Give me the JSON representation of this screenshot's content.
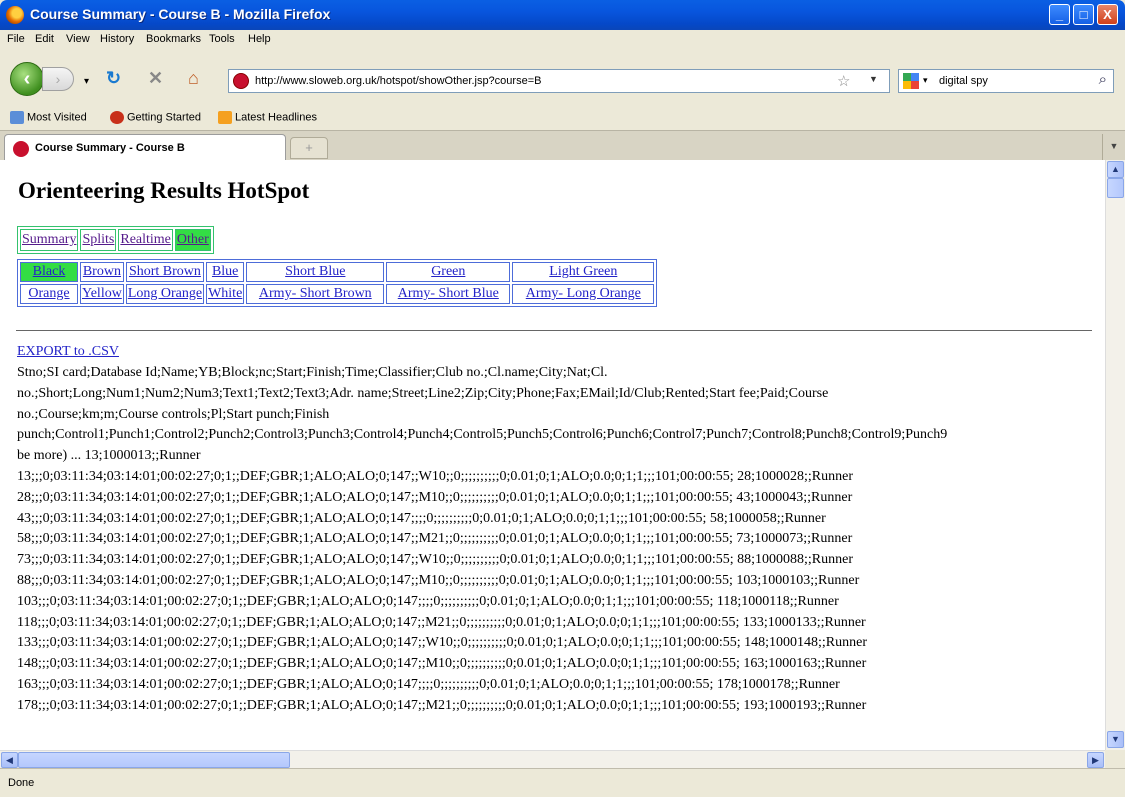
{
  "window": {
    "title": "Course Summary - Course B - Mozilla Firefox",
    "minimize": "_",
    "maximize": "□",
    "close": "X"
  },
  "menu": {
    "items": [
      "File",
      "Edit",
      "View",
      "History",
      "Bookmarks",
      "Tools",
      "Help"
    ]
  },
  "navbar": {
    "url": "http://www.sloweb.org.uk/hotspot/showOther.jsp?course=B",
    "search_query": "digital spy"
  },
  "bookmarks": {
    "items": [
      "Most Visited",
      "Getting Started",
      "Latest Headlines"
    ]
  },
  "tabs": {
    "active_label": "Course Summary - Course B",
    "new_tab": "+"
  },
  "page": {
    "heading": "Orienteering Results HotSpot",
    "topnav": [
      "Summary",
      "Splits",
      "Realtime",
      "Other"
    ],
    "courses_row1": [
      "Black",
      "Brown",
      "Short Brown",
      "Blue",
      "Short Blue",
      "Green",
      "Light Green"
    ],
    "courses_row2": [
      "Orange",
      "Yellow",
      "Long Orange",
      "White",
      "Army- Short Brown",
      "Army- Short Blue",
      "Army- Long Orange"
    ],
    "export_link": "EXPORT to .CSV",
    "lines": [
      "Stno;SI card;Database Id;Name;YB;Block;nc;Start;Finish;Time;Classifier;Club no.;Cl.name;City;Nat;Cl.",
      "no.;Short;Long;Num1;Num2;Num3;Text1;Text2;Text3;Adr. name;Street;Line2;Zip;City;Phone;Fax;EMail;Id/Club;Rented;Start fee;Paid;Course",
      "no.;Course;km;m;Course controls;Pl;Start punch;Finish",
      "punch;Control1;Punch1;Control2;Punch2;Control3;Punch3;Control4;Punch4;Control5;Punch5;Control6;Punch6;Control7;Punch7;Control8;Punch8;Control9;Punch9",
      "be more) ... 13;1000013;;Runner",
      "13;;;0;03:11:34;03:14:01;00:02:27;0;1;;DEF;GBR;1;ALO;ALO;0;147;;W10;;0;;;;;;;;;;0;0.01;0;1;ALO;0.0;0;1;1;;;101;00:00:55; 28;1000028;;Runner",
      "28;;;0;03:11:34;03:14:01;00:02:27;0;1;;DEF;GBR;1;ALO;ALO;0;147;;M10;;0;;;;;;;;;;0;0.01;0;1;ALO;0.0;0;1;1;;;101;00:00:55; 43;1000043;;Runner",
      "43;;;0;03:11:34;03:14:01;00:02:27;0;1;;DEF;GBR;1;ALO;ALO;0;147;;;;0;;;;;;;;;;0;0.01;0;1;ALO;0.0;0;1;1;;;101;00:00:55; 58;1000058;;Runner",
      "58;;;0;03:11:34;03:14:01;00:02:27;0;1;;DEF;GBR;1;ALO;ALO;0;147;;M21;;0;;;;;;;;;;0;0.01;0;1;ALO;0.0;0;1;1;;;101;00:00:55; 73;1000073;;Runner",
      "73;;;0;03:11:34;03:14:01;00:02:27;0;1;;DEF;GBR;1;ALO;ALO;0;147;;W10;;0;;;;;;;;;;0;0.01;0;1;ALO;0.0;0;1;1;;;101;00:00:55; 88;1000088;;Runner",
      "88;;;0;03:11:34;03:14:01;00:02:27;0;1;;DEF;GBR;1;ALO;ALO;0;147;;M10;;0;;;;;;;;;;0;0.01;0;1;ALO;0.0;0;1;1;;;101;00:00:55; 103;1000103;;Runner",
      "103;;;0;03:11:34;03:14:01;00:02:27;0;1;;DEF;GBR;1;ALO;ALO;0;147;;;;0;;;;;;;;;;0;0.01;0;1;ALO;0.0;0;1;1;;;101;00:00:55; 118;1000118;;Runner",
      "118;;;0;03:11:34;03:14:01;00:02:27;0;1;;DEF;GBR;1;ALO;ALO;0;147;;M21;;0;;;;;;;;;;0;0.01;0;1;ALO;0.0;0;1;1;;;101;00:00:55; 133;1000133;;Runner",
      "133;;;0;03:11:34;03:14:01;00:02:27;0;1;;DEF;GBR;1;ALO;ALO;0;147;;W10;;0;;;;;;;;;;0;0.01;0;1;ALO;0.0;0;1;1;;;101;00:00:55; 148;1000148;;Runner",
      "148;;;0;03:11:34;03:14:01;00:02:27;0;1;;DEF;GBR;1;ALO;ALO;0;147;;M10;;0;;;;;;;;;;0;0.01;0;1;ALO;0.0;0;1;1;;;101;00:00:55; 163;1000163;;Runner",
      "163;;;0;03:11:34;03:14:01;00:02:27;0;1;;DEF;GBR;1;ALO;ALO;0;147;;;;0;;;;;;;;;;0;0.01;0;1;ALO;0.0;0;1;1;;;101;00:00:55; 178;1000178;;Runner",
      "178;;;0;03:11:34;03:14:01;00:02:27;0;1;;DEF;GBR;1;ALO;ALO;0;147;;M21;;0;;;;;;;;;;0;0.01;0;1;ALO;0.0;0;1;1;;;101;00:00:55; 193;1000193;;Runner"
    ]
  },
  "status": {
    "text": "Done"
  },
  "colors": {
    "active_tab": "#33dd44",
    "link": "#2323c8",
    "visited": "#551a8b",
    "titlebar": "#0855dd"
  }
}
